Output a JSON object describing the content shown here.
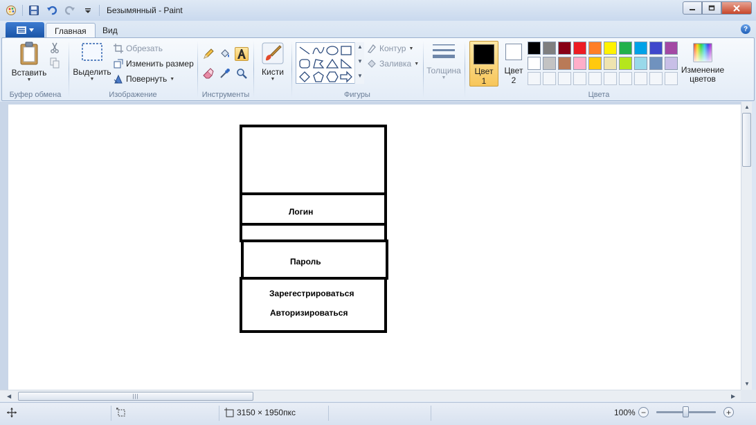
{
  "window": {
    "title": "Безымянный - Paint"
  },
  "tabs": [
    {
      "label": "Главная",
      "active": true
    },
    {
      "label": "Вид",
      "active": false
    }
  ],
  "ribbon": {
    "clipboard": {
      "paste_label": "Вставить",
      "group_label": "Буфер обмена"
    },
    "image": {
      "select_label": "Выделить",
      "crop_label": "Обрезать",
      "resize_label": "Изменить размер",
      "rotate_label": "Повернуть",
      "group_label": "Изображение"
    },
    "tools": {
      "group_label": "Инструменты",
      "selected_tool": "text"
    },
    "brushes": {
      "label": "Кисти"
    },
    "shapes": {
      "group_label": "Фигуры",
      "outline_label": "Контур",
      "fill_label": "Заливка"
    },
    "size": {
      "label": "Толщина"
    },
    "colors": {
      "color1_label": "Цвет",
      "color1_num": "1",
      "color1_value": "#000000",
      "color2_label": "Цвет",
      "color2_num": "2",
      "color2_value": "#ffffff",
      "edit_label_line1": "Изменение",
      "edit_label_line2": "цветов",
      "group_label": "Цвета",
      "palette_row1": [
        "#000000",
        "#7f7f7f",
        "#880015",
        "#ed1c24",
        "#ff7f27",
        "#fff200",
        "#22b14c",
        "#00a2e8",
        "#3f48cc",
        "#a349a4"
      ],
      "palette_row2": [
        "#ffffff",
        "#c3c3c3",
        "#b97a57",
        "#ffaec9",
        "#ffc90e",
        "#efe4b0",
        "#b5e61d",
        "#99d9ea",
        "#7092be",
        "#c8bfe7"
      ]
    }
  },
  "drawing": {
    "login_label": "Логин",
    "password_label": "Пароль",
    "register_label": "Зарегестрироваться",
    "authorize_label": "Авторизироваться"
  },
  "statusbar": {
    "image_size": "3150 × 1950пкс",
    "zoom": "100%"
  }
}
